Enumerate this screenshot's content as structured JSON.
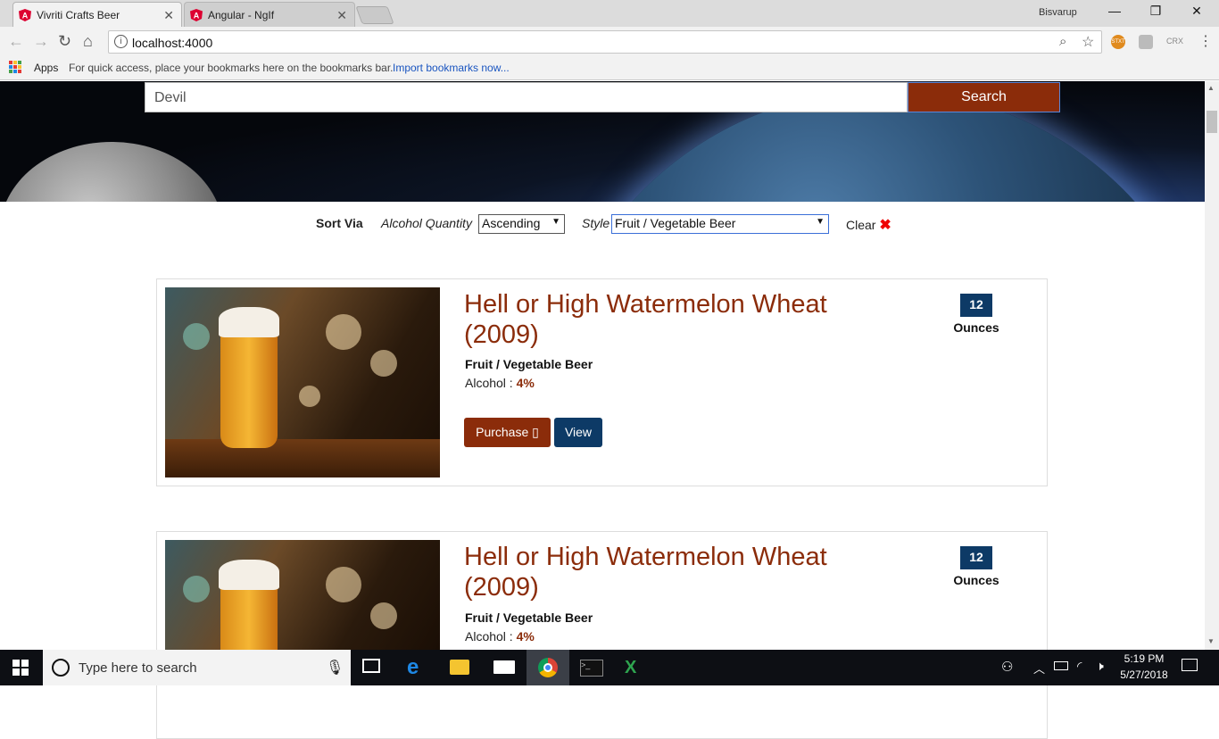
{
  "browser": {
    "tabs": [
      {
        "title": "Vivriti Crafts Beer",
        "active": true
      },
      {
        "title": "Angular - NgIf",
        "active": false
      }
    ],
    "user": "Bisvarup",
    "url": "localhost:4000",
    "bookmarks": {
      "apps": "Apps",
      "hint": "For quick access, place your bookmarks here on the bookmarks bar.",
      "import_link": "Import bookmarks now..."
    },
    "extensions": [
      "STXT",
      "CRX"
    ]
  },
  "search": {
    "value": "Devil",
    "button_label": "Search"
  },
  "sort": {
    "label": "Sort Via",
    "alcohol_label": "Alcohol Quantity",
    "alcohol_value": "Ascending",
    "style_label": "Style",
    "style_value": "Fruit / Vegetable Beer",
    "clear_label": "Clear"
  },
  "beers": [
    {
      "name": "Hell or High Watermelon Wheat (2009)",
      "style": "Fruit / Vegetable Beer",
      "alcohol_label": "Alcohol : ",
      "alcohol_value": "4%",
      "ounces": "12",
      "ounces_label": "Ounces",
      "purchase_label": "Purchase",
      "view_label": "View"
    },
    {
      "name": "Hell or High Watermelon Wheat (2009)",
      "style": "Fruit / Vegetable Beer",
      "alcohol_label": "Alcohol : ",
      "alcohol_value": "4%",
      "ounces": "12",
      "ounces_label": "Ounces"
    }
  ],
  "taskbar": {
    "search_placeholder": "Type here to search",
    "time": "5:19 PM",
    "date": "5/27/2018"
  },
  "colors": {
    "accent": "#8b2c0a",
    "navy": "#0d3a66"
  }
}
